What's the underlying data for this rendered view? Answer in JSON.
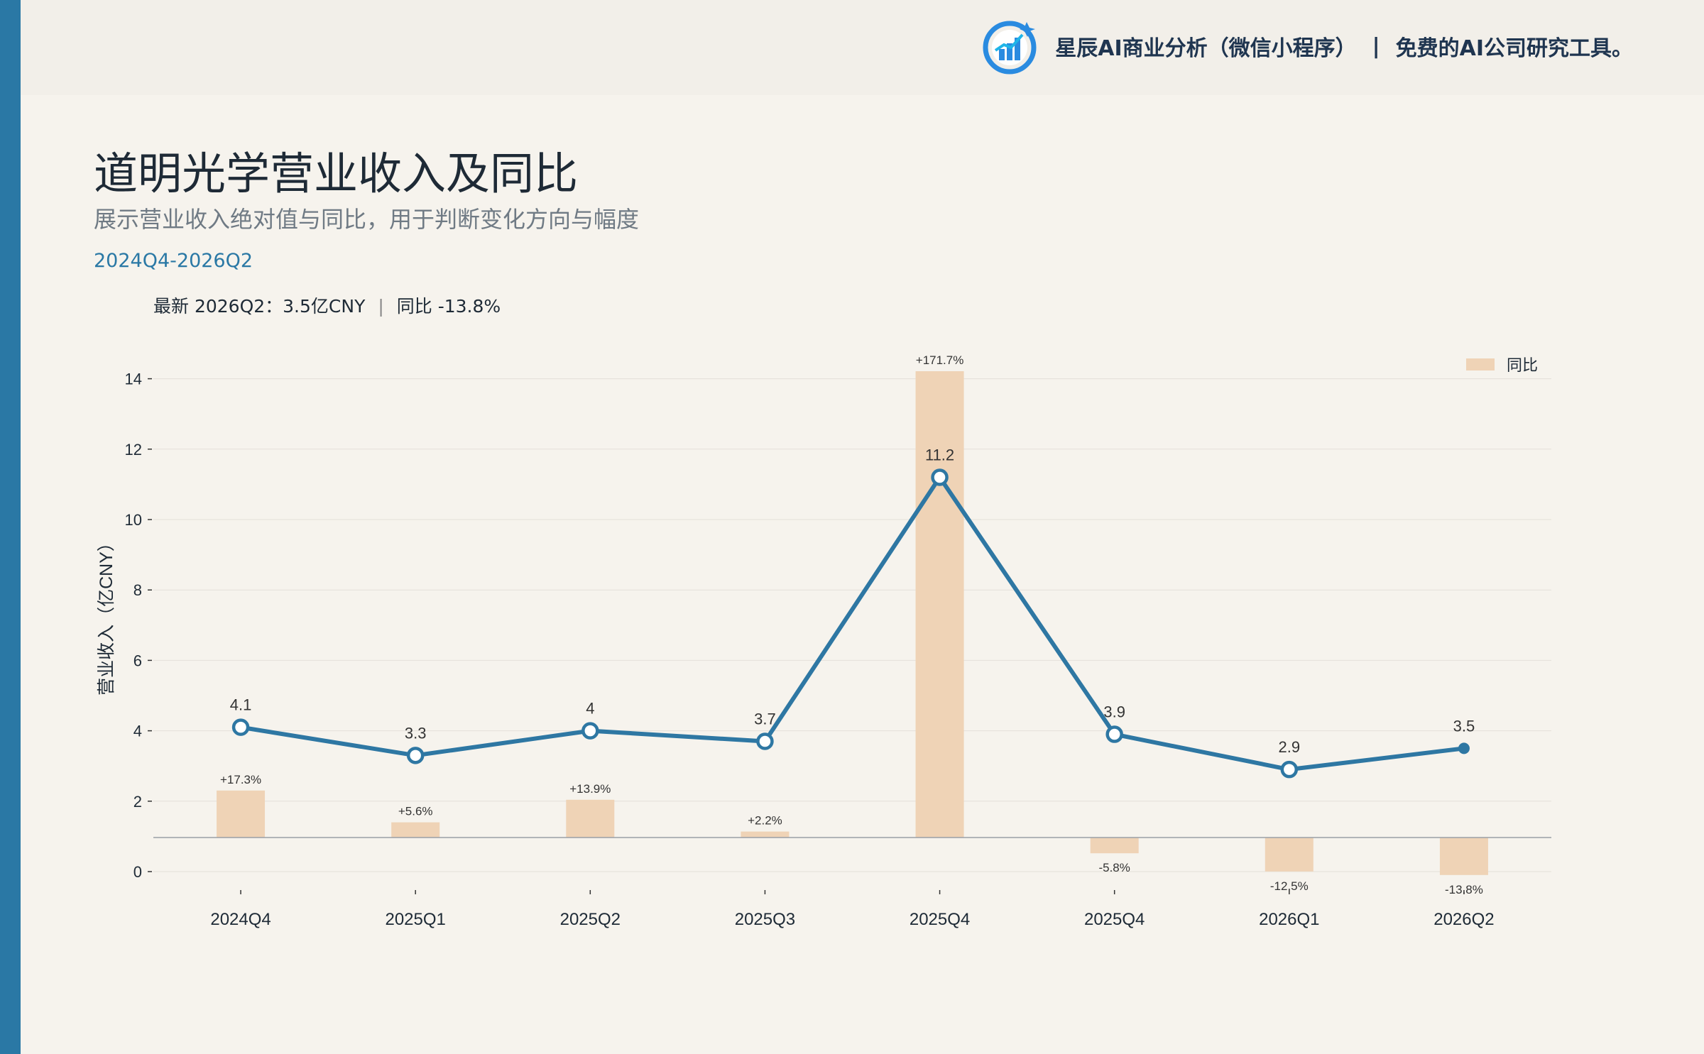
{
  "header": {
    "brand_name": "星辰AI商业分析（微信小程序）",
    "separator": "|",
    "tagline": "免费的AI公司研究工具。",
    "logo_icon": "bar-chart-logo-icon"
  },
  "title": "道明光学营业收入及同比",
  "subtitle": "展示营业收入绝对值与同比，用于判断变化方向与幅度",
  "range": "2024Q4-2026Q2",
  "latest": {
    "value_text": "最新 2026Q2：3.5亿CNY",
    "separator": "|",
    "yoy_text": "同比 -13.8%"
  },
  "colors": {
    "accent": "#2a78a5",
    "line": "#2e77a3",
    "bar": "#efd3b6",
    "background": "#f6f3ed"
  },
  "chart_data": {
    "type": "line",
    "categories": [
      "2024Q4",
      "2025Q1",
      "2025Q2",
      "2025Q3",
      "2025Q4",
      "2025Q4",
      "2026Q1",
      "2026Q2"
    ],
    "series": [
      {
        "kind": "line",
        "values": [
          4.1,
          3.3,
          4.0,
          3.7,
          11.2,
          3.9,
          2.9,
          3.5
        ],
        "labels": [
          "4.1",
          "3.3",
          "4",
          "3.7",
          "11.2",
          "3.9",
          "2.9",
          "3.5"
        ]
      },
      {
        "kind": "bar",
        "name": "同比",
        "values": [
          17.3,
          5.6,
          13.9,
          2.2,
          171.7,
          -5.8,
          -12.5,
          -13.8
        ],
        "labels": [
          "+17.3%",
          "+5.6%",
          "+13.9%",
          "+2.2%",
          "+171.7%",
          "-5.8%",
          "-12.5%",
          "-13.8%"
        ]
      }
    ],
    "ylabel": "营业收入（亿CNY）",
    "ylim": [
      0,
      14.5
    ],
    "yticks": [
      "0",
      "2",
      "4",
      "6",
      "8",
      "10",
      "12",
      "14"
    ],
    "grid": true,
    "legend_position": "top-right"
  }
}
